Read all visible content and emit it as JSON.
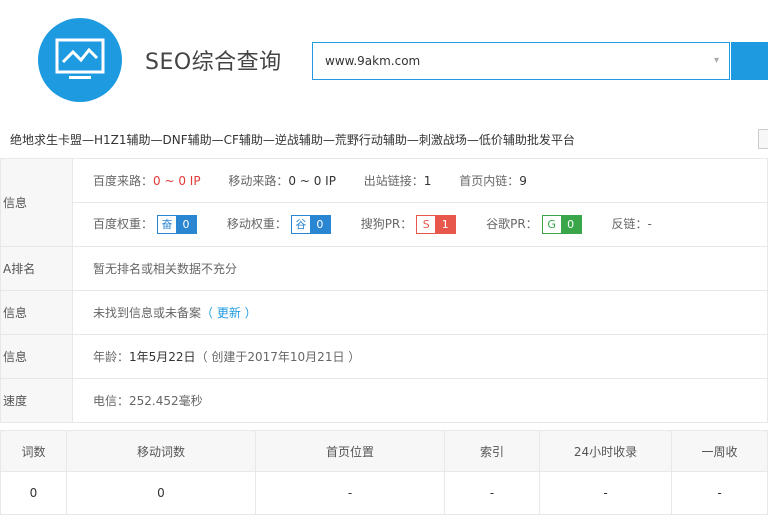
{
  "header": {
    "title": "SEO综合查询",
    "search_value": "www.9akm.com"
  },
  "marquee": "绝地求生卡盟—H1Z1辅助—DNF辅助—CF辅助—逆战辅助—荒野行动辅助—刺激战场—低价辅助批发平台",
  "rows": [
    {
      "label": "信息",
      "items": [
        {
          "k": "百度来路：",
          "v": "0 ~ 0 IP"
        },
        {
          "k": "移动来路：",
          "v": "0 ~ 0 IP"
        },
        {
          "k": "出站链接：",
          "v": "1"
        },
        {
          "k": "首页内链：",
          "v": "9"
        }
      ],
      "badges": [
        {
          "k": "百度权重：",
          "icon": "奋",
          "num": "0"
        },
        {
          "k": "移动权重：",
          "icon": "谷",
          "num": "0"
        },
        {
          "k": "搜狗PR：",
          "icon": "S",
          "num": "1"
        },
        {
          "k": "谷歌PR：",
          "icon": "G",
          "num": "0"
        }
      ],
      "extra": "反链：-"
    },
    {
      "label": "A排名",
      "text": "暂无排名或相关数据不充分"
    },
    {
      "label": "信息",
      "text": "未找到信息或未备案",
      "link": "（ 更新 ）"
    },
    {
      "label": "信息",
      "age_key": "年龄：",
      "age_val": "1年5月22日",
      "age_note": "（ 创建于2017年10月21日 ）"
    },
    {
      "label": "速度",
      "text": "电信：252.452毫秒"
    }
  ],
  "keywords_table": {
    "headers": [
      "词数",
      "移动词数",
      "首页位置",
      "索引",
      "24小时收录",
      "一周收"
    ],
    "rows": [
      [
        "0",
        "0",
        "-",
        "-",
        "-",
        "-"
      ]
    ]
  }
}
